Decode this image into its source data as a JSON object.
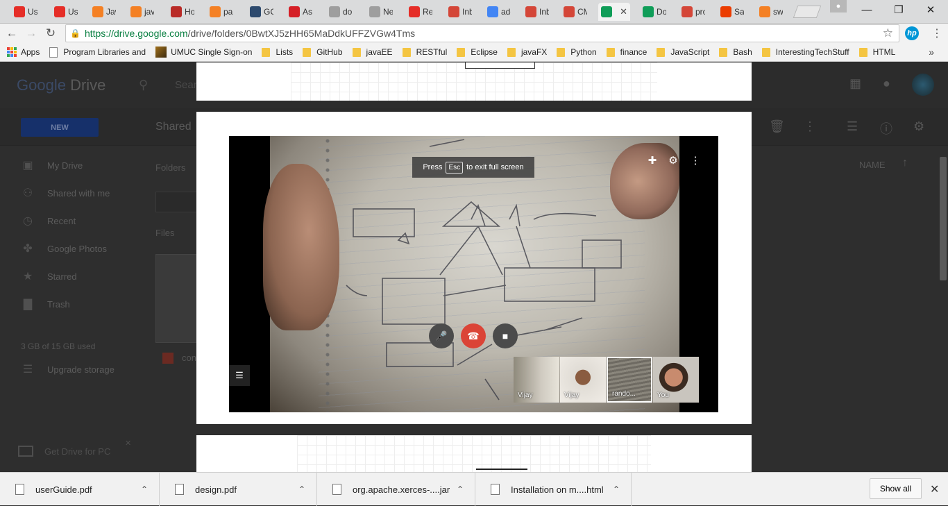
{
  "browser": {
    "tabs": [
      {
        "label": "Usi",
        "icon": "youtube-icon",
        "color": "#e52d27"
      },
      {
        "label": "Usi",
        "icon": "youtube-icon",
        "color": "#e52d27"
      },
      {
        "label": "Javi",
        "icon": "stackoverflow-icon",
        "color": "#f48024"
      },
      {
        "label": "java",
        "icon": "stackoverflow-icon",
        "color": "#f48024"
      },
      {
        "label": "Hov",
        "icon": "quora-icon",
        "color": "#b92b27"
      },
      {
        "label": "par",
        "icon": "stackoverflow-icon",
        "color": "#f48024"
      },
      {
        "label": "GC",
        "icon": "gc-icon",
        "color": "#2d4a6e"
      },
      {
        "label": "Ask",
        "icon": "ask-icon",
        "color": "#d51f26"
      },
      {
        "label": "doi",
        "icon": "doc-icon",
        "color": "#9e9e9e"
      },
      {
        "label": "Nel",
        "icon": "doc-icon",
        "color": "#9e9e9e"
      },
      {
        "label": "Rea",
        "icon": "youtube-icon",
        "color": "#e52d27"
      },
      {
        "label": "Inb",
        "icon": "gmail-icon",
        "color": "#d44638"
      },
      {
        "label": "adc",
        "icon": "google-icon",
        "color": "#4285f4"
      },
      {
        "label": "Inb",
        "icon": "gmail-icon",
        "color": "#d44638"
      },
      {
        "label": "CM",
        "icon": "gmail-icon",
        "color": "#d44638"
      },
      {
        "label": "",
        "icon": "drive-icon",
        "color": "#0f9d58"
      },
      {
        "label": "Dou",
        "icon": "drive-icon",
        "color": "#0f9d58"
      },
      {
        "label": "pro",
        "icon": "gmail-icon",
        "color": "#d44638"
      },
      {
        "label": "Sav",
        "icon": "office-icon",
        "color": "#eb3c00"
      },
      {
        "label": "swi",
        "icon": "stackoverflow-icon",
        "color": "#f48024"
      }
    ],
    "url": {
      "secure": "https://drive.google.com",
      "path": "/drive/folders/0BwtXJ5zHH65MaDdkUFFZVGw4Tms"
    },
    "hp_label": "hp",
    "bookmarks": [
      {
        "label": "Apps",
        "type": "apps"
      },
      {
        "label": "Program Libraries and",
        "type": "file"
      },
      {
        "label": "UMUC Single Sign-on",
        "type": "umuc"
      },
      {
        "label": "Lists",
        "type": "folder"
      },
      {
        "label": "GitHub",
        "type": "folder"
      },
      {
        "label": "javaEE",
        "type": "folder"
      },
      {
        "label": "RESTful",
        "type": "folder"
      },
      {
        "label": "Eclipse",
        "type": "folder"
      },
      {
        "label": "javaFX",
        "type": "folder"
      },
      {
        "label": "Python",
        "type": "folder"
      },
      {
        "label": "finance",
        "type": "folder"
      },
      {
        "label": "JavaScript",
        "type": "folder"
      },
      {
        "label": "Bash",
        "type": "folder"
      },
      {
        "label": "InterestingTechStuff",
        "type": "folder"
      },
      {
        "label": "HTML",
        "type": "folder"
      }
    ],
    "bookmarks_more": "»"
  },
  "drive": {
    "logo_google": "Google",
    "logo_drive": "Drive",
    "search_placeholder": "Sear",
    "new_label": "NEW",
    "breadcrumb": "Shared",
    "nav": [
      {
        "label": "My Drive",
        "icon": "drive-folder-icon"
      },
      {
        "label": "Shared with me",
        "icon": "people-icon"
      },
      {
        "label": "Recent",
        "icon": "clock-icon"
      },
      {
        "label": "Google Photos",
        "icon": "pinwheel-icon"
      },
      {
        "label": "Starred",
        "icon": "star-icon"
      },
      {
        "label": "Trash",
        "icon": "trash-icon"
      }
    ],
    "storage": "3 GB of 15 GB used",
    "upgrade": "Upgrade storage",
    "folders_label": "Folders",
    "files_label": "Files",
    "file_partial": "con",
    "name_col": "NAME",
    "get_drive": "Get Drive for PC"
  },
  "hangout": {
    "esc_press": "Press",
    "esc_key": "Esc",
    "esc_tail": "to exit full screen",
    "participants": [
      {
        "name": "Vijay"
      },
      {
        "name": "Vijay"
      },
      {
        "name": "rando..."
      },
      {
        "name": "You"
      }
    ]
  },
  "downloads": [
    {
      "name": "userGuide.pdf"
    },
    {
      "name": "design.pdf"
    },
    {
      "name": "org.apache.xerces-....jar"
    },
    {
      "name": "Installation on m....html"
    }
  ],
  "show_all": "Show all"
}
